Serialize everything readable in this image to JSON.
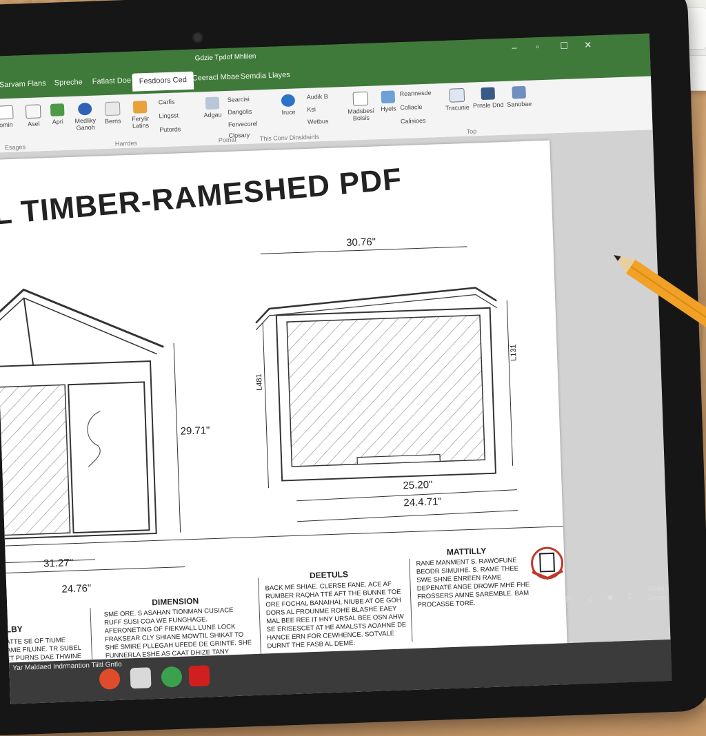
{
  "window": {
    "title": "Gdzie Tpdof Mhlilen",
    "controls": [
      "–",
      "▫",
      "☐",
      "✕"
    ]
  },
  "tabs": [
    {
      "label": "Sarvam Flans"
    },
    {
      "label": "Spreche"
    },
    {
      "label": "Fatlast Doe"
    },
    {
      "label": "Fesdoors Ced",
      "active": true
    },
    {
      "label": "Ceeracl Mbae"
    },
    {
      "label": "Semdia Llayes"
    }
  ],
  "ribbon": {
    "buttons": [
      {
        "label": "omin",
        "icon": "page-icon"
      },
      {
        "label": "Asel",
        "icon": "doc-icon"
      },
      {
        "label": "Apri",
        "icon": "home-icon"
      },
      {
        "label": "Medliky Ganoh",
        "icon": "brush-icon"
      },
      {
        "label": "Berns",
        "icon": "grid-icon"
      },
      {
        "label": "Ferylir Latins",
        "icon": "fill-icon"
      },
      {
        "label": "Carfis",
        "icon": "cursor-icon"
      },
      {
        "label": "Lingsst",
        "icon": "link-icon"
      },
      {
        "label": "Putords",
        "icon": "add-icon"
      },
      {
        "label": "Adgau",
        "icon": "image-icon"
      },
      {
        "label": "Searcisi",
        "icon": "shape-icon"
      },
      {
        "label": "Dangolis",
        "icon": "draw-icon"
      },
      {
        "label": "Fervecorel",
        "icon": "format-icon"
      },
      {
        "label": "Closary",
        "icon": "list-icon"
      },
      {
        "label": "Iruce",
        "icon": "info-icon"
      },
      {
        "label": "Audik B",
        "icon": "audio-icon"
      },
      {
        "label": "Ksi",
        "icon": "text-icon"
      },
      {
        "label": "Wetbus",
        "icon": "web-icon"
      },
      {
        "label": "Madsbesi Bolsis",
        "icon": "book-icon"
      },
      {
        "label": "Hyels",
        "icon": "hyper-icon"
      },
      {
        "label": "Reannesde",
        "icon": "rename-icon"
      },
      {
        "label": "Collacle",
        "icon": "collate-icon"
      },
      {
        "label": "Calisioes",
        "icon": "cal-icon"
      },
      {
        "label": "Tracunie",
        "icon": "track-icon"
      },
      {
        "label": "Prnsle Dnd",
        "icon": "print-icon"
      },
      {
        "label": "Sanobae",
        "icon": "save-icon"
      }
    ],
    "groups": [
      "Esages",
      "Harrdes",
      "Pomal",
      "This Conv Dinsidsinls",
      "Top"
    ]
  },
  "document": {
    "title": "L TIMBER-RAMESHED PDF",
    "dims": {
      "front_height": "29.71\"",
      "front_width_inner": "31.27\"",
      "front_width_outer": "24.76\"",
      "side_top": "30.76\"",
      "side_left": "L481",
      "side_right": "L131",
      "side_bottom_inner": "25.20\"",
      "side_bottom_outer": "24.4.71\""
    },
    "sections": [
      {
        "heading": "DIMENSION",
        "text": "SME ORE. S ASAHAN TIONMAN CUSIACE RUFF SUSI COA WE FUNGHAGE. AFERONETING OF FIEKWALL LUNE LOCK FRAKSEAR CLY SHIANE MOWTIL SHIKAT TO SHE SMIRE PLLEGAH UFEDE DE GRINTE. SHE FUNNERLA ESHE AS CAAT DHIZE TANY SMOHNE FOLL CAPLANCE, SHEEYO WINE."
      },
      {
        "heading": "DEETULS",
        "text": "BACK ME SHIAE. CLERSE FANE. ACE AF RUMBER RAQHA TTE AFT THE BUNNE TOE ORE FOCHAL BANAIHAL NIUBE AT OE GOH DORS AL FROUNME ROHE BLASHE EAEY MAL BEE REE IT HNY URSAL BEE OSN AHW SE ERISESCET AT HE AMALSTS AOAHNE DE HANCE ERN FOR CEWHENCE. SOTVALE DURNT THE FASB AL DEME."
      },
      {
        "heading": "MATTILLY",
        "text": "RANE MANMENT S. RAWOFUNE BEODR SIMUIHE. S. RAME THEE SWE SHNE ENREEN RAME DEPENATE ANGE DROWF MHE FHE FROSSERS AMNE SAREMBLE. BAM PROCASSE TORE."
      },
      {
        "heading": "LLBY",
        "text": "SATTE SE OF TIUME RAME FILUNE. TR SUBEL LET PURNS DAE THWINE AP TE LAWS ST SHINE LAGDREE. TE SHENDING CATE."
      }
    ]
  },
  "taskbar": {
    "app_label": "Yar Maldaed Indrmantion  Tiiltl Gntlo",
    "tray": [
      "ℙ",
      "◁",
      "✺",
      "⁑",
      "Sbud",
      "Daner"
    ]
  },
  "colors": {
    "accent_green": "#3f7a3a",
    "page_white": "#ffffff",
    "seal_red": "#c0392b"
  }
}
